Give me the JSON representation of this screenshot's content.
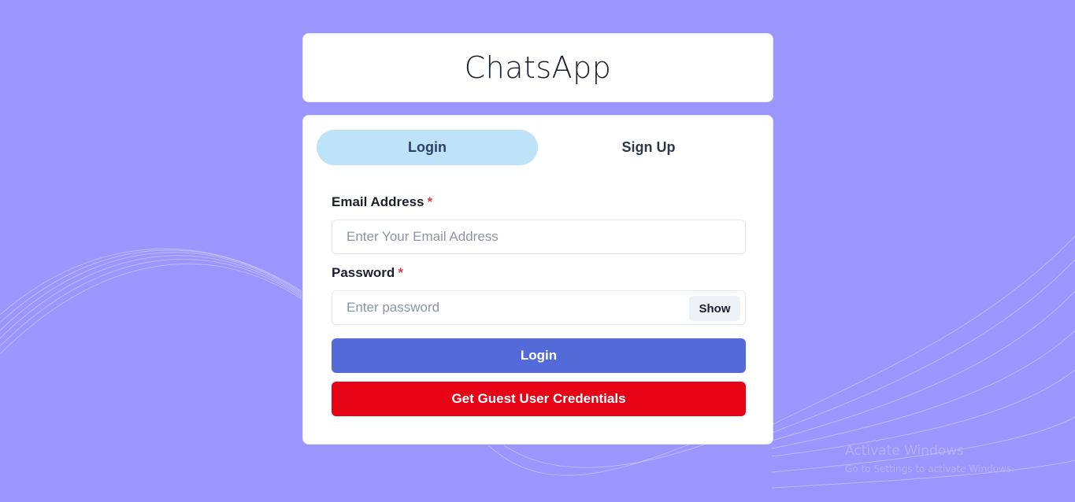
{
  "app": {
    "title": "ChatsApp"
  },
  "tabs": [
    {
      "label": "Login",
      "active": true
    },
    {
      "label": "Sign Up",
      "active": false
    }
  ],
  "form": {
    "email": {
      "label": "Email Address",
      "required_mark": "*",
      "placeholder": "Enter Your Email Address",
      "value": ""
    },
    "password": {
      "label": "Password",
      "required_mark": "*",
      "placeholder": "Enter password",
      "value": "",
      "show_label": "Show"
    },
    "login_label": "Login",
    "guest_label": "Get Guest User Credentials"
  },
  "watermark": {
    "title": "Activate Windows",
    "subtitle": "Go to Settings to activate Windows."
  },
  "colors": {
    "background": "#9b95fe",
    "active_tab": "#bee3f8",
    "login_button": "#536ad8",
    "guest_button": "#e60315",
    "required": "#e53e3e"
  }
}
